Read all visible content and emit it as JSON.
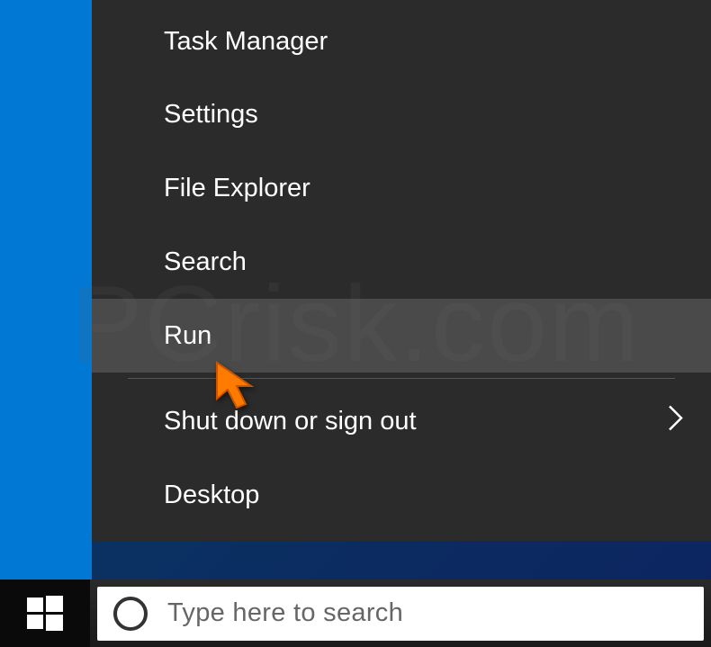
{
  "contextMenu": {
    "items": [
      {
        "label": "Task Manager",
        "hovered": false,
        "hasSubmenu": false
      },
      {
        "label": "Settings",
        "hovered": false,
        "hasSubmenu": false
      },
      {
        "label": "File Explorer",
        "hovered": false,
        "hasSubmenu": false
      },
      {
        "label": "Search",
        "hovered": false,
        "hasSubmenu": false
      },
      {
        "label": "Run",
        "hovered": true,
        "hasSubmenu": false
      }
    ],
    "afterDivider": [
      {
        "label": "Shut down or sign out",
        "hovered": false,
        "hasSubmenu": true
      },
      {
        "label": "Desktop",
        "hovered": false,
        "hasSubmenu": false
      }
    ]
  },
  "search": {
    "placeholder": "Type here to search"
  },
  "watermark": "PCrisk.com"
}
